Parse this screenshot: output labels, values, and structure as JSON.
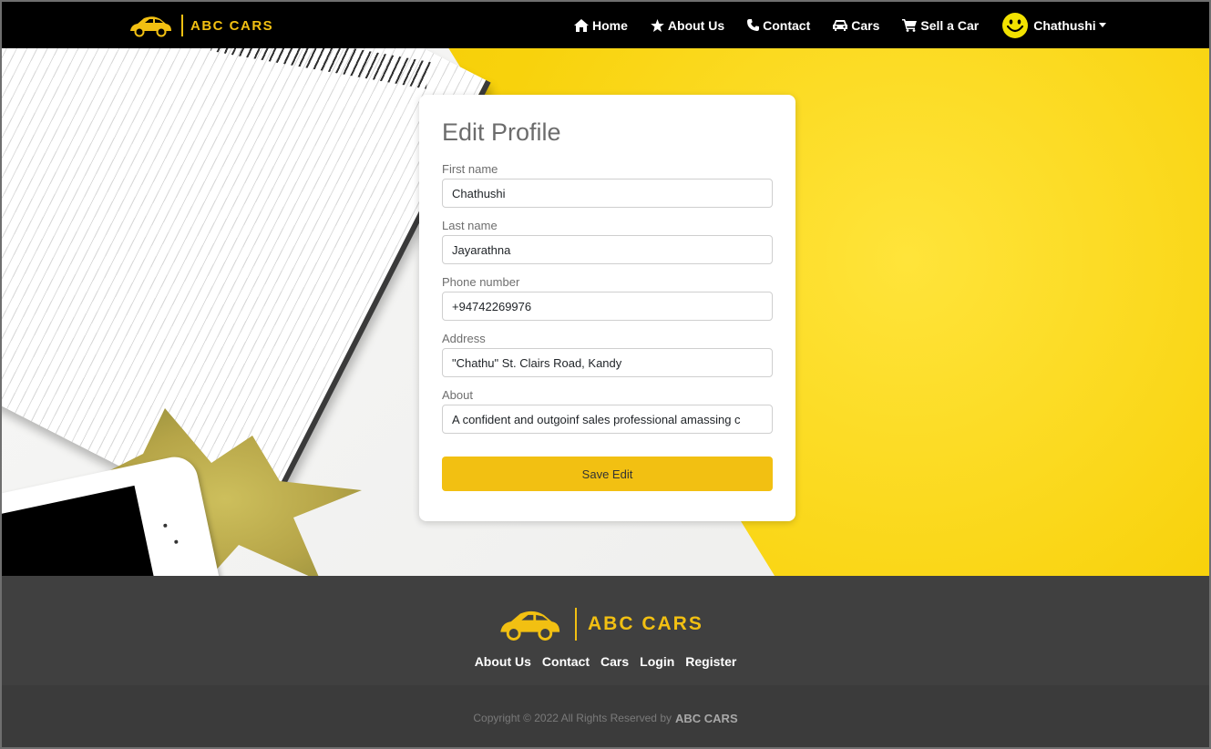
{
  "brand": {
    "name": "ABC CARS"
  },
  "nav": {
    "items": [
      {
        "label": "Home",
        "icon": "home-icon"
      },
      {
        "label": "About Us",
        "icon": "star-icon"
      },
      {
        "label": "Contact",
        "icon": "phone-icon"
      },
      {
        "label": "Cars",
        "icon": "car-icon"
      },
      {
        "label": "Sell a Car",
        "icon": "cart-icon"
      }
    ],
    "user": {
      "name": "Chathushi",
      "avatar_icon": "smiley-icon"
    }
  },
  "form": {
    "title": "Edit Profile",
    "fields": [
      {
        "label": "First name",
        "value": "Chathushi"
      },
      {
        "label": "Last name",
        "value": "Jayarathna"
      },
      {
        "label": "Phone number",
        "value": "+94742269976"
      },
      {
        "label": "Address",
        "value": "\"Chathu\" St. Clairs Road, Kandy"
      },
      {
        "label": "About",
        "value": "A confident and outgoinf sales professional amassing c"
      }
    ],
    "submit_label": "Save Edit"
  },
  "footer": {
    "brand": "ABC CARS",
    "links": [
      "About Us",
      "Contact",
      "Cars",
      "Login",
      "Register"
    ],
    "copyright_prefix": "Copyright © 2022 All Rights Reserved by",
    "copyright_brand": "ABC CARS"
  },
  "colors": {
    "accent": "#f2c012",
    "navbar": "#000000",
    "footer": "#404040",
    "copyright": "#3b3b3b"
  }
}
